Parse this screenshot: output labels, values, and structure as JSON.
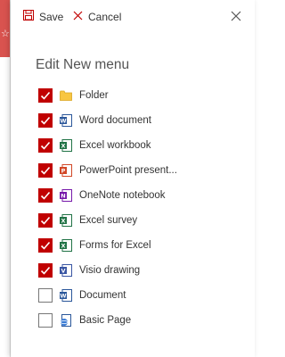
{
  "toolbar": {
    "save_label": "Save",
    "cancel_label": "Cancel"
  },
  "panel": {
    "title": "Edit New menu"
  },
  "colors": {
    "accent": "#c00000",
    "word": "#2b579a",
    "excel": "#217346",
    "powerpoint": "#d24726",
    "onenote": "#7719aa",
    "visio": "#3955a3",
    "folder": "#f8c642"
  },
  "items": [
    {
      "label": "Folder",
      "checked": true,
      "icon": "folder-icon"
    },
    {
      "label": "Word document",
      "checked": true,
      "icon": "word-icon"
    },
    {
      "label": "Excel workbook",
      "checked": true,
      "icon": "excel-icon"
    },
    {
      "label": "PowerPoint present...",
      "checked": true,
      "icon": "powerpoint-icon"
    },
    {
      "label": "OneNote notebook",
      "checked": true,
      "icon": "onenote-icon"
    },
    {
      "label": "Excel survey",
      "checked": true,
      "icon": "excel-icon"
    },
    {
      "label": "Forms for Excel",
      "checked": true,
      "icon": "excel-icon"
    },
    {
      "label": "Visio drawing",
      "checked": true,
      "icon": "visio-icon"
    },
    {
      "label": "Document",
      "checked": false,
      "icon": "word-icon"
    },
    {
      "label": "Basic Page",
      "checked": false,
      "icon": "page-icon"
    }
  ]
}
